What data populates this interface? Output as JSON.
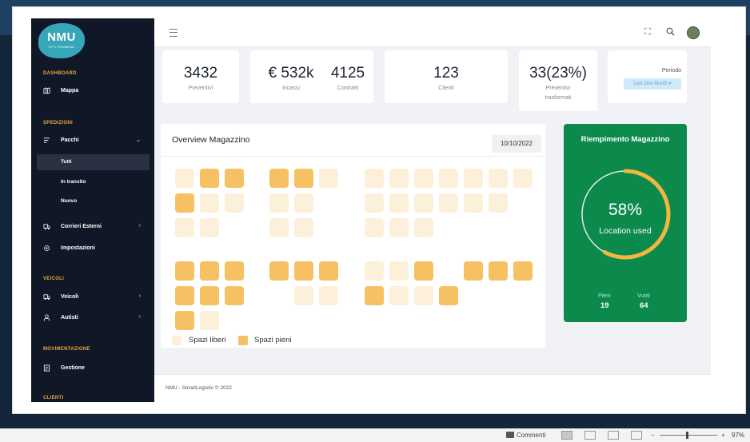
{
  "sidebar": {
    "logo": {
      "main": "NMU",
      "sub": "CITY ROAMING"
    },
    "sections": {
      "dashboard": "DASHBOARD",
      "spedizioni": "SPEDIZIONI",
      "veicoli": "VEICOLI",
      "movimentazione": "MOVIMENTAZIONE",
      "clienti": "CLIENTI"
    },
    "items": {
      "mappa": "Mappa",
      "pacchi": "Pacchi",
      "tutti": "Tutti",
      "in_transito": "In transito",
      "nuovo": "Nuovo",
      "corrieri_esterni": "Corrieri Esterni",
      "impostazioni": "Impostazioni",
      "veicoli": "Veicoli",
      "autisti": "Autisti",
      "gestione": "Gestione"
    },
    "active_item": "Tutti"
  },
  "kpis": {
    "preventivi": {
      "value": "3432",
      "label": "Preventivi"
    },
    "incassi": {
      "value": "€ 532k",
      "label": "Incassi"
    },
    "contratti": {
      "value": "4125",
      "label": "Contratti"
    },
    "clienti": {
      "value": "123",
      "label": "Clienti"
    },
    "trasformati": {
      "value": "33(23%)",
      "label_line1": "Preventivi",
      "label_line2": "trasformati"
    },
    "periodo": {
      "label": "Periodo",
      "button": "Last One Month ▾"
    }
  },
  "overview": {
    "title": "Overview Magazzino",
    "date": "10/10/2022",
    "legend": {
      "liberi": "Spazi liberi",
      "pieni": "Spazi pieni"
    },
    "colors": {
      "libero": "#fdf0db",
      "pieno": "#f5c163"
    }
  },
  "riempimento": {
    "title": "Riempimento Magazzino",
    "percent_text": "58%",
    "percent": 58,
    "label": "Location used",
    "pieni_label": "Pieni",
    "pieni_value": "19",
    "vuoti_label": "Vuoti",
    "vuoti_value": "64",
    "colors": {
      "card": "#0b8a4c",
      "arc": "#f3b640"
    }
  },
  "footer": {
    "text": "NMU - SmartLogistic © 2022"
  },
  "statusbar": {
    "comments": "Commenti",
    "zoom": "97%"
  }
}
